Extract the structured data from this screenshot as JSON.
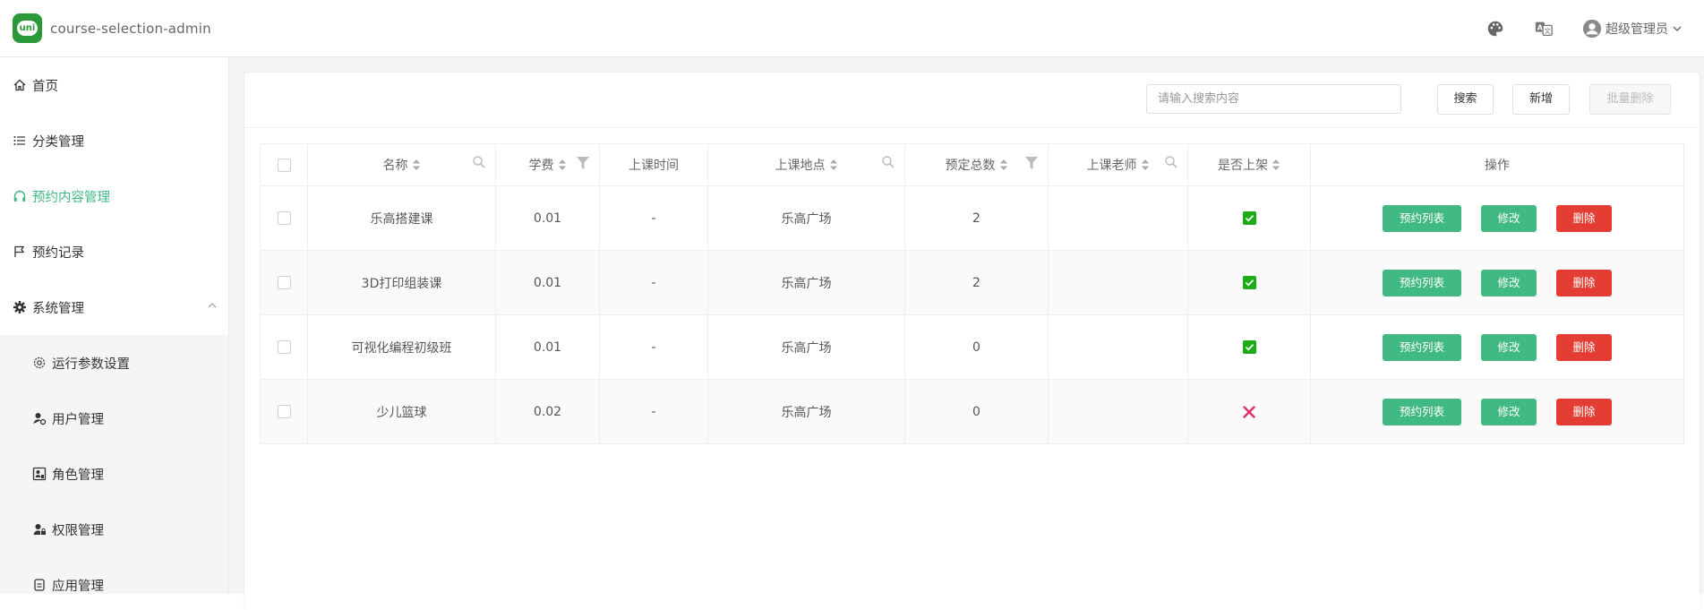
{
  "header": {
    "logo_text": "uni",
    "app_title": "course-selection-admin",
    "user_name": "超级管理员"
  },
  "sidebar": {
    "items": [
      {
        "label": "首页",
        "icon": "home-icon"
      },
      {
        "label": "分类管理",
        "icon": "list-icon"
      },
      {
        "label": "预约内容管理",
        "icon": "headphones-icon",
        "active": true
      },
      {
        "label": "预约记录",
        "icon": "flag-icon"
      },
      {
        "label": "系统管理",
        "icon": "gear-icon",
        "expanded": true
      },
      {
        "label": "运行参数设置",
        "icon": "settings-icon",
        "sub": true
      },
      {
        "label": "用户管理",
        "icon": "user-gear-icon",
        "sub": true
      },
      {
        "label": "角色管理",
        "icon": "role-icon",
        "sub": true
      },
      {
        "label": "权限管理",
        "icon": "user-lock-icon",
        "sub": true
      },
      {
        "label": "应用管理",
        "icon": "app-icon",
        "sub": true
      }
    ]
  },
  "toolbar": {
    "search_placeholder": "请输入搜索内容",
    "search_label": "搜索",
    "add_label": "新增",
    "batch_delete_label": "批量删除"
  },
  "table": {
    "columns": [
      "名称",
      "学费",
      "上课时间",
      "上课地点",
      "预定总数",
      "上课老师",
      "是否上架",
      "操作"
    ],
    "rows": [
      {
        "name": "乐高搭建课",
        "fee": "0.01",
        "time": "-",
        "location": "乐高广场",
        "total": "2",
        "teacher": "",
        "on_shelf": true
      },
      {
        "name": "3D打印组装课",
        "fee": "0.01",
        "time": "-",
        "location": "乐高广场",
        "total": "2",
        "teacher": "",
        "on_shelf": true
      },
      {
        "name": "可视化编程初级班",
        "fee": "0.01",
        "time": "-",
        "location": "乐高广场",
        "total": "0",
        "teacher": "",
        "on_shelf": true
      },
      {
        "name": "少儿篮球",
        "fee": "0.02",
        "time": "-",
        "location": "乐高广场",
        "total": "0",
        "teacher": "",
        "on_shelf": false
      }
    ],
    "actions": {
      "list_label": "预约列表",
      "edit_label": "修改",
      "delete_label": "删除"
    }
  },
  "colors": {
    "accent": "#42b983",
    "danger": "#e43d33",
    "logo": "#2b9939",
    "off_shelf": "#e0306a"
  }
}
